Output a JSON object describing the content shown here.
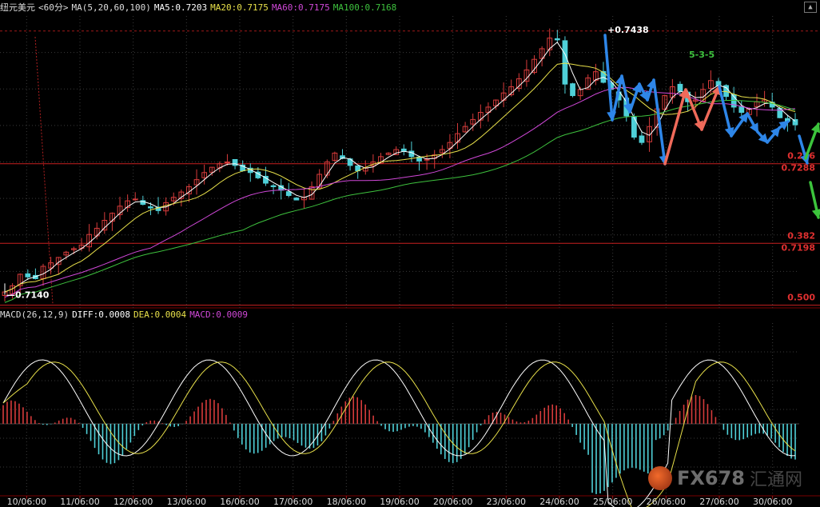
{
  "header": {
    "symbol": "纽元美元",
    "period": "<60分>",
    "ma_label": "MA(5,20,60,100)",
    "ma5": "MA5:0.7203",
    "ma20": "MA20:0.7175",
    "ma60": "MA60:0.7175",
    "ma100": "MA100:0.7168"
  },
  "macd_header": {
    "label": "MACD(26,12,9)",
    "diff": "DIFF:0.0008",
    "dea": "DEA:0.0004",
    "macd": "MACD:0.0009"
  },
  "colors": {
    "up": "#d63b3b",
    "down": "#4fd0d8",
    "ma5": "#ffffff",
    "ma20": "#e8e04a",
    "ma60": "#d048d8",
    "ma100": "#3ec23e",
    "fib": "#c82020",
    "wave_blue": "#2e86e8",
    "wave_red": "#f06a5a",
    "wave_green": "#3cc43c"
  },
  "watermark": {
    "brand": "FX678",
    "cn": "汇通网"
  },
  "chart_data": {
    "type": "candlestick",
    "price_ylim": [
      0.7125,
      0.7455
    ],
    "x_ticks": [
      "10/06:00",
      "11/06:00",
      "12/06:00",
      "13/06:00",
      "16/06:00",
      "17/06:00",
      "18/06:00",
      "19/06:00",
      "20/06:00",
      "23/06:00",
      "24/06:00",
      "25/06:00",
      "26/06:00",
      "27/06:00",
      "30/06:00"
    ],
    "annotations": {
      "high": "0.7438",
      "low": "0.7140",
      "wave_label": "5-3-5"
    },
    "fib_levels": [
      {
        "ratio": "0.236",
        "price": "0.7288",
        "value": 0.7288
      },
      {
        "ratio": "0.382",
        "price": "0.7198",
        "value": 0.7198
      },
      {
        "ratio": "0.500",
        "price": "",
        "value": 0.7128
      }
    ],
    "ma_series_latest": {
      "MA5": 0.7203,
      "MA20": 0.7175,
      "MA60": 0.7175,
      "MA100": 0.7168
    },
    "close_series": [
      0.7143,
      0.715,
      0.7163,
      0.716,
      0.7158,
      0.7172,
      0.7176,
      0.7182,
      0.7188,
      0.7192,
      0.7196,
      0.7208,
      0.7215,
      0.7224,
      0.7232,
      0.724,
      0.7246,
      0.7248,
      0.7242,
      0.7238,
      0.7235,
      0.7244,
      0.725,
      0.7256,
      0.7262,
      0.727,
      0.7278,
      0.7284,
      0.7288,
      0.729,
      0.7286,
      0.728,
      0.7278,
      0.7272,
      0.7266,
      0.7262,
      0.7258,
      0.7252,
      0.7247,
      0.725,
      0.7262,
      0.7276,
      0.729,
      0.73,
      0.7294,
      0.7286,
      0.728,
      0.7283,
      0.729,
      0.7296,
      0.73,
      0.7304,
      0.7302,
      0.7296,
      0.7291,
      0.7293,
      0.7298,
      0.7304,
      0.7312,
      0.7322,
      0.733,
      0.7338,
      0.7346,
      0.7352,
      0.736,
      0.7368,
      0.7375,
      0.7384,
      0.7394,
      0.7406,
      0.7418,
      0.743,
      0.7428,
      0.7378,
      0.7365,
      0.7372,
      0.7385,
      0.7392,
      0.738,
      0.7372,
      0.736,
      0.7342,
      0.7318,
      0.7312,
      0.733,
      0.735,
      0.7365,
      0.7375,
      0.737,
      0.7358,
      0.736,
      0.7372,
      0.7382,
      0.7376,
      0.7364,
      0.7352,
      0.7346,
      0.735,
      0.7358,
      0.736,
      0.7352,
      0.734,
      0.7336,
      0.7332
    ],
    "macd": {
      "diff_latest": 0.0008,
      "dea_latest": 0.0004,
      "macd_latest": 0.0009
    }
  }
}
